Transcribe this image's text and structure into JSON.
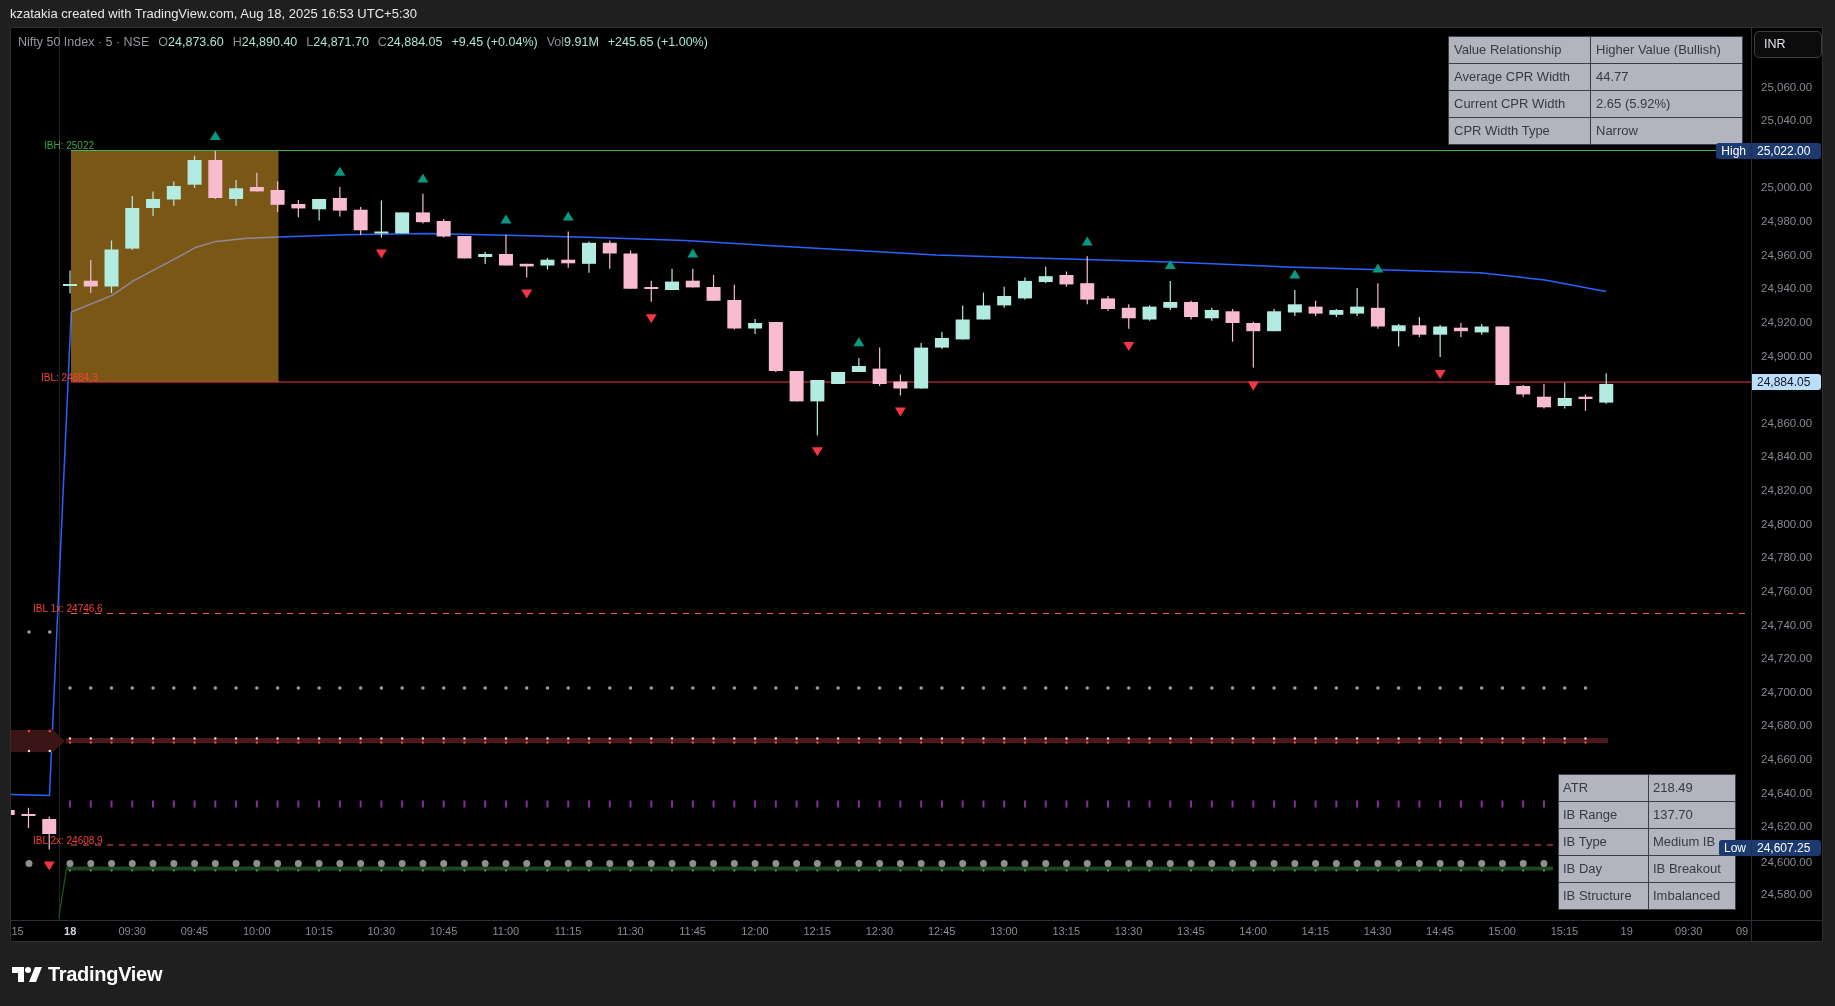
{
  "attribution": "kzatakia created with TradingView.com, Aug 18, 2025 16:53 UTC+5:30",
  "legend": {
    "symbol": "Nifty 50 Index · 5 · NSE",
    "fields": [
      {
        "label": "O",
        "value": "24,873.60"
      },
      {
        "label": "H",
        "value": "24,890.40"
      },
      {
        "label": "L",
        "value": "24,871.70"
      },
      {
        "label": "C",
        "value": "24,884.05"
      },
      {
        "value": "+9.45 (+0.04%)"
      },
      {
        "label": "Vol",
        "value": "9.91M"
      },
      {
        "value": "+245.65 (+1.00%)"
      }
    ]
  },
  "levels": [
    {
      "kind": "high",
      "label": "IBH: 25022"
    },
    {
      "kind": "low",
      "label": "IBL: 24884.3"
    },
    {
      "kind": "extension",
      "label": "IBL 1x: 24746.6"
    },
    {
      "kind": "extension",
      "label": "IBL 2x: 24608.9"
    }
  ],
  "cpr_table": [
    {
      "label": "Value Relationship",
      "value": "Higher Value (Bullish)"
    },
    {
      "label": "Average CPR Width",
      "value": "44.77"
    },
    {
      "label": "Current CPR Width",
      "value": "2.65 (5.92%)"
    },
    {
      "label": "CPR Width Type",
      "value": "Narrow"
    }
  ],
  "ib_table": [
    {
      "label": "ATR",
      "value": "218.49"
    },
    {
      "label": "IB Range",
      "value": "137.70"
    },
    {
      "label": "IB Type",
      "value": "Medium IB"
    },
    {
      "label": "IB Day",
      "value": "IB Breakout"
    },
    {
      "label": "IB Structure",
      "value": "Imbalanced"
    }
  ],
  "currency_button": "INR",
  "price_axis": {
    "labels": [
      "25,060.00",
      "25,040.00",
      "25,000.00",
      "24,980.00",
      "24,960.00",
      "24,940.00",
      "24,920.00",
      "24,900.00",
      "24,860.00",
      "24,840.00",
      "24,820.00",
      "24,800.00",
      "24,780.00",
      "24,760.00",
      "24,740.00",
      "24,720.00",
      "24,700.00",
      "24,680.00",
      "24,660.00",
      "24,640.00",
      "24,620.00",
      "24,600.00",
      "24,580.00"
    ],
    "badges": [
      {
        "kind": "high",
        "label": "High",
        "value": "25,022.00"
      },
      {
        "kind": "last",
        "value": "24,884.05"
      },
      {
        "kind": "low",
        "label": "Low",
        "value": "24,607.25"
      }
    ]
  },
  "time_axis": {
    "labels": [
      {
        "text": "15",
        "kind": "time"
      },
      {
        "text": "18",
        "kind": "day"
      },
      {
        "text": "09:30",
        "kind": "time"
      },
      {
        "text": "09:45",
        "kind": "time"
      },
      {
        "text": "10:00",
        "kind": "time"
      },
      {
        "text": "10:15",
        "kind": "time"
      },
      {
        "text": "10:30",
        "kind": "time"
      },
      {
        "text": "10:45",
        "kind": "time"
      },
      {
        "text": "11:00",
        "kind": "time"
      },
      {
        "text": "11:15",
        "kind": "time"
      },
      {
        "text": "11:30",
        "kind": "time"
      },
      {
        "text": "11:45",
        "kind": "time"
      },
      {
        "text": "12:00",
        "kind": "time"
      },
      {
        "text": "12:15",
        "kind": "time"
      },
      {
        "text": "12:30",
        "kind": "time"
      },
      {
        "text": "12:45",
        "kind": "time"
      },
      {
        "text": "13:00",
        "kind": "time"
      },
      {
        "text": "13:15",
        "kind": "time"
      },
      {
        "text": "13:30",
        "kind": "time"
      },
      {
        "text": "13:45",
        "kind": "time"
      },
      {
        "text": "14:00",
        "kind": "time"
      },
      {
        "text": "14:15",
        "kind": "time"
      },
      {
        "text": "14:30",
        "kind": "time"
      },
      {
        "text": "14:45",
        "kind": "time"
      },
      {
        "text": "15:00",
        "kind": "time"
      },
      {
        "text": "15:15",
        "kind": "time"
      },
      {
        "text": "19",
        "kind": "day"
      },
      {
        "text": "09:30",
        "kind": "time"
      },
      {
        "text": "09",
        "kind": "time"
      }
    ]
  },
  "branding": "TradingView"
}
